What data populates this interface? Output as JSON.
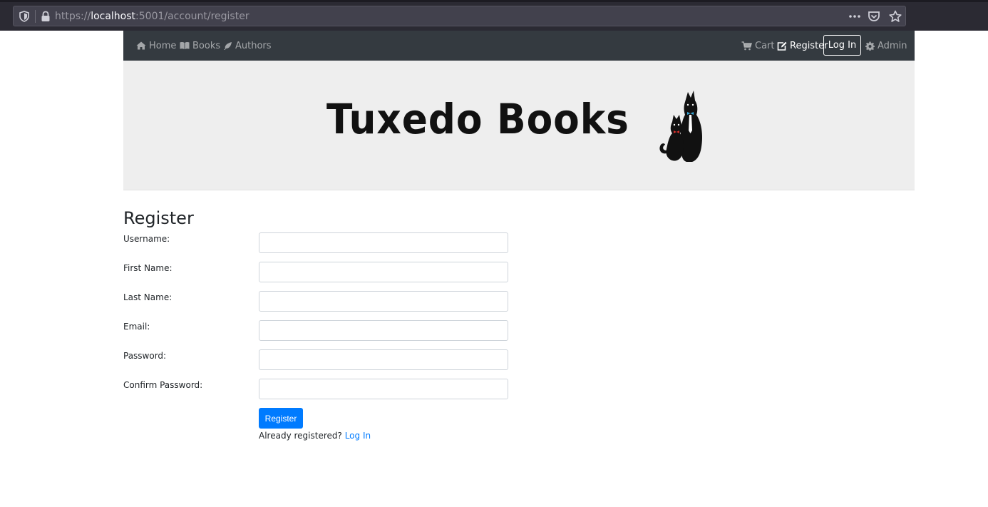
{
  "browser": {
    "url_scheme": "https://",
    "url_host": "localhost",
    "url_rest": ":5001/account/register"
  },
  "nav": {
    "home": "Home",
    "books": "Books",
    "authors": "Authors",
    "cart": "Cart",
    "register": "Register",
    "login": "Log In",
    "admin": "Admin"
  },
  "banner": {
    "logo_text": "Tuxedo Books"
  },
  "form": {
    "title": "Register",
    "fields": [
      {
        "label": "Username:",
        "value": ""
      },
      {
        "label": "First Name:",
        "value": ""
      },
      {
        "label": "Last Name:",
        "value": ""
      },
      {
        "label": "Email:",
        "value": ""
      },
      {
        "label": "Password:",
        "value": ""
      },
      {
        "label": "Confirm Password:",
        "value": ""
      }
    ],
    "submit_label": "Register",
    "already_text": "Already registered?",
    "login_link": "Log In"
  },
  "colors": {
    "navbar": "#343a40",
    "primary": "#007bff",
    "banner_bg": "#eeeeee"
  },
  "icons": [
    "shield-icon",
    "lock-icon",
    "more-icon",
    "pocket-icon",
    "star-icon",
    "home-icon",
    "book-icon",
    "feather-icon",
    "cart-icon",
    "edit-icon",
    "gear-icon"
  ]
}
